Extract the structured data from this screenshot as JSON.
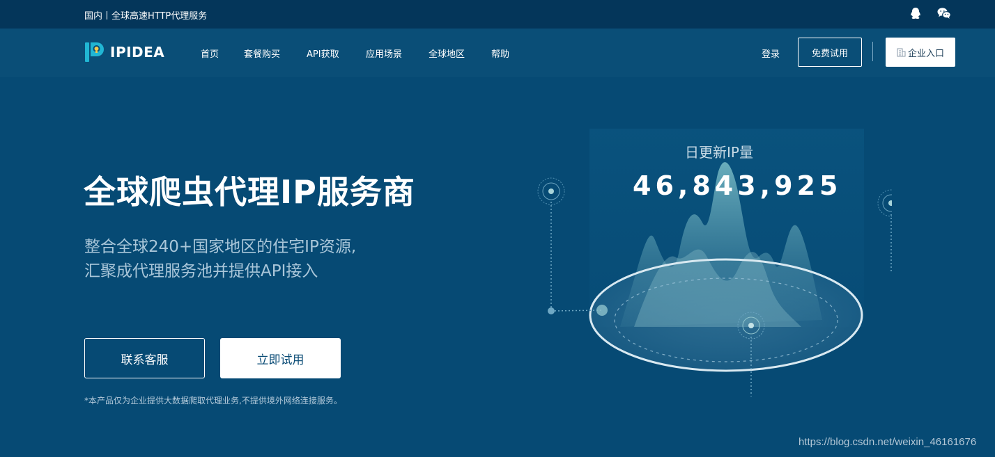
{
  "topbar": {
    "tagline": "国内丨全球高速HTTP代理服务",
    "icons": [
      "qq-icon",
      "wechat-icon"
    ]
  },
  "nav": {
    "logo_text": "IPIDEA",
    "items": [
      "首页",
      "套餐购买",
      "API获取",
      "应用场景",
      "全球地区",
      "帮助"
    ],
    "login": "登录",
    "trial": "免费试用",
    "enterprise": "企业入口"
  },
  "hero": {
    "title": "全球爬虫代理IP服务商",
    "subtitle_line1": "整合全球240+国家地区的住宅IP资源,",
    "subtitle_line2": "汇聚成代理服务池并提供API接入",
    "contact_button": "联系客服",
    "try_button": "立即试用",
    "note": "*本产品仅为企业提供大数据爬取代理业务,不提供境外网络连接服务。"
  },
  "stats": {
    "label": "日更新IP量",
    "value": "46,843,925"
  },
  "watermark": "https://blog.csdn.net/weixin_46161676",
  "colors": {
    "background": "#064a74",
    "topbar": "#04365a",
    "accent": "#21b6d4"
  }
}
